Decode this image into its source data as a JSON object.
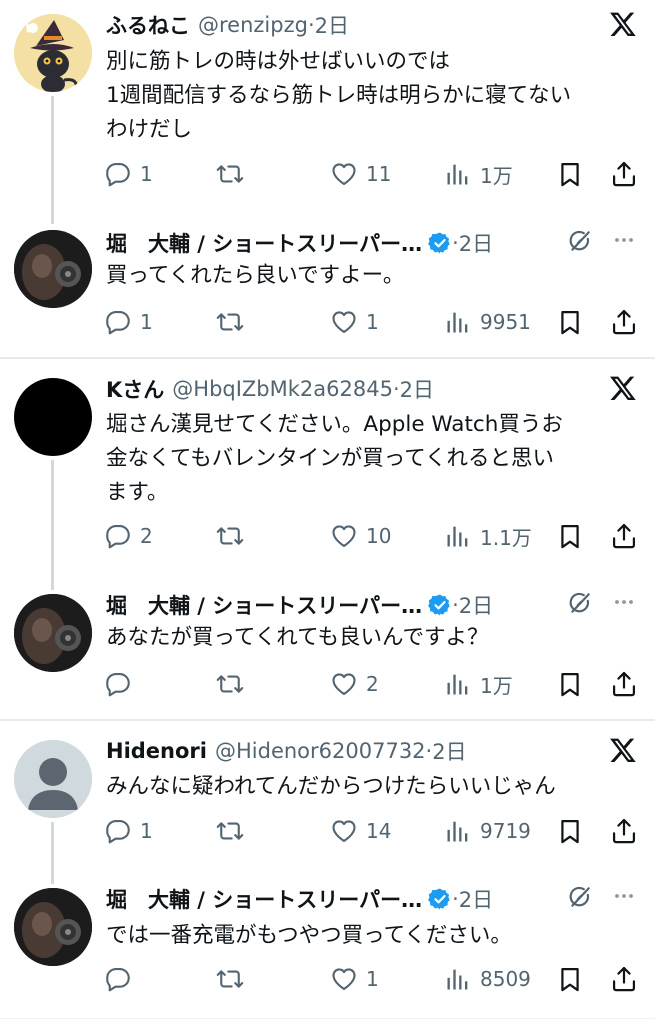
{
  "tweets": [
    {
      "name": "ふるねこ",
      "handle": "@renzipzg",
      "dot": "·",
      "time": "2日",
      "lines": [
        "別に筋トレの時は外せばいいのでは",
        "1週間配信するなら筋トレ時は明らかに寝てない",
        "わけだし"
      ],
      "reply": "1",
      "retweet": "",
      "like": "11",
      "views": "1万"
    },
    {
      "name": "堀　大輔 / ショートスリーパー…",
      "handle": "",
      "dot": "·",
      "time": "2日",
      "lines": [
        "買ってくれたら良いですよー。"
      ],
      "reply": "1",
      "retweet": "",
      "like": "1",
      "views": "9951"
    },
    {
      "name": "Kさん",
      "handle": "@HbqIZbMk2a62845",
      "dot": "·",
      "time": "2日",
      "lines": [
        "堀さん漢見せてください。Apple Watch買うお",
        "金なくてもバレンタインが買ってくれると思い",
        "ます。"
      ],
      "reply": "2",
      "retweet": "",
      "like": "10",
      "views": "1.1万"
    },
    {
      "name": "堀　大輔 / ショートスリーパー…",
      "handle": "",
      "dot": "·",
      "time": "2日",
      "lines": [
        "あなたが買ってくれても良いんですよ？"
      ],
      "reply": "",
      "retweet": "",
      "like": "2",
      "views": "1万"
    },
    {
      "name": "Hidenori",
      "handle": "@Hidenor62007732",
      "dot": "·",
      "time": "2日",
      "lines": [
        "みんなに疑われてんだからつけたらいいじゃん"
      ],
      "reply": "1",
      "retweet": "",
      "like": "14",
      "views": "9719"
    },
    {
      "name": "堀　大輔 / ショートスリーパー…",
      "handle": "",
      "dot": "·",
      "time": "2日",
      "lines": [
        "では一番充電がもつやつ買ってください。"
      ],
      "reply": "",
      "retweet": "",
      "like": "1",
      "views": "8509"
    }
  ],
  "colors": {
    "text": "#0f1419",
    "secondary": "#536471",
    "verified": "#1d9bf0",
    "thread_line": "#cfd9de"
  },
  "icons": [
    "reply-icon",
    "retweet-icon",
    "like-icon",
    "views-icon",
    "bookmark-icon",
    "share-icon",
    "x-logo-icon",
    "grok-icon",
    "more-icon",
    "verified-badge-icon"
  ]
}
